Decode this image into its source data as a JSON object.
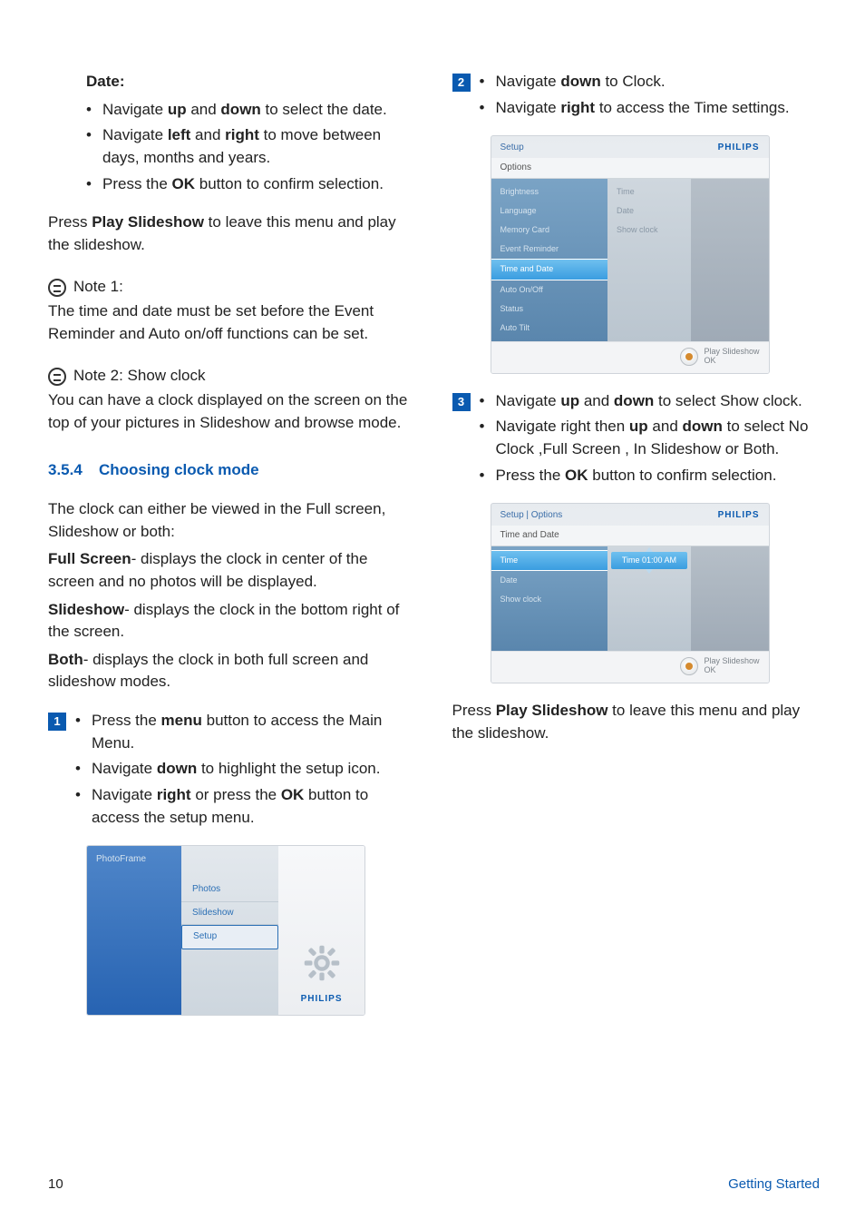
{
  "left": {
    "date_heading": "Date:",
    "date_bullets": [
      {
        "pre": "Navigate ",
        "b1": "up",
        "mid1": " and ",
        "b2": "down",
        "post": " to select the date."
      },
      {
        "pre": "Navigate ",
        "b1": "left",
        "mid1": " and ",
        "b2": "right",
        "post": " to move between days, months and years."
      },
      {
        "pre": "Press the ",
        "b1": "OK",
        "post": " button to confirm selection."
      }
    ],
    "press_play_pre": "Press ",
    "press_play_bold": "Play Slideshow",
    "press_play_post": " to leave this menu and play the slideshow.",
    "note1_label": "Note 1:",
    "note1_body": "The time and date must be set before the Event Reminder and Auto on/off functions can be set.",
    "note2_label": "Note 2: Show clock",
    "note2_body": "You can have a clock displayed on the screen on the top of your pictures in Slideshow and browse mode.",
    "section_num": "3.5.4",
    "section_title": "Choosing clock mode",
    "intro": "The clock can either be viewed in the Full screen, Slideshow or both:",
    "full_label": "Full Screen",
    "full_body": "- displays the clock in center of the screen and no photos will be displayed.",
    "slideshow_label": "Slideshow",
    "slideshow_body": "- displays the clock in the bottom right of the screen.",
    "both_label": "Both",
    "both_body": "- displays the clock in both full screen and slideshow modes.",
    "step1": [
      {
        "pre": "Press the ",
        "b1": "menu",
        "post": " button to access the Main Menu."
      },
      {
        "pre": "Navigate ",
        "b1": "down",
        "post": " to highlight the setup icon."
      },
      {
        "pre": "Navigate ",
        "b1": "right",
        "mid1": " or press the ",
        "b2": "OK",
        "post": " button to access the setup menu."
      }
    ],
    "dev1": {
      "title": "PhotoFrame",
      "items": [
        "Photos",
        "Slideshow",
        "Setup"
      ],
      "brand": "PHILIPS"
    }
  },
  "right": {
    "step2": [
      {
        "pre": "Navigate ",
        "b1": "down",
        "post": " to Clock."
      },
      {
        "pre": "Navigate ",
        "b1": "right",
        "post": " to access the Time settings."
      }
    ],
    "dev2": {
      "crumb": "Setup",
      "brand": "PHILIPS",
      "sub": "Options",
      "left_items": [
        "Brightness",
        "Language",
        "Memory Card",
        "Event Reminder",
        "Time and Date",
        "Auto On/Off",
        "Status",
        "Auto Tilt"
      ],
      "left_hl_index": 4,
      "mid_items": [
        "Time",
        "Date",
        "Show clock"
      ],
      "footer1": "Play Slideshow",
      "footer2": "OK"
    },
    "step3": [
      {
        "pre": "Navigate ",
        "b1": "up",
        "mid1": " and ",
        "b2": "down",
        "post": " to select Show clock."
      },
      {
        "pre": "Navigate right then ",
        "b1": "up",
        "mid1": " and ",
        "b2": "down",
        "post": " to select No Clock ,Full Screen , In Slideshow or Both."
      },
      {
        "pre": "Press the ",
        "b1": "OK",
        "post": " button to confirm selection."
      }
    ],
    "dev3": {
      "crumb": "Setup | Options",
      "brand": "PHILIPS",
      "sub": "Time and Date",
      "left_items": [
        "Time",
        "Date",
        "Show clock"
      ],
      "left_hl_index": 0,
      "time_value": "Time  01:00 AM",
      "footer1": "Play Slideshow",
      "footer2": "OK"
    },
    "press_play_pre": "Press ",
    "press_play_bold": "Play Slideshow",
    "press_play_post": " to leave this menu and play the slideshow."
  },
  "footer": {
    "page": "10",
    "section": "Getting Started"
  }
}
